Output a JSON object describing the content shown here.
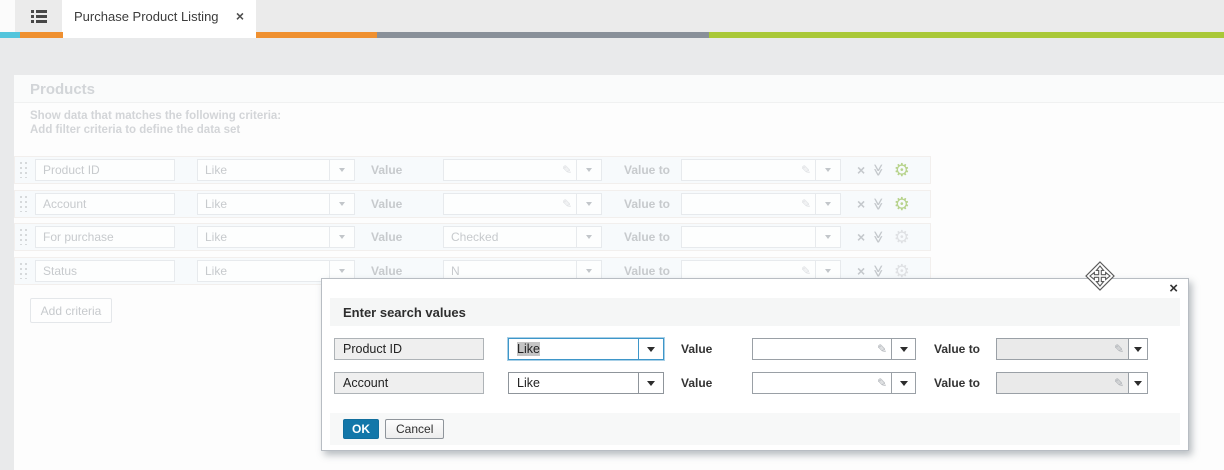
{
  "tab_bar": {
    "tab_label": "Purchase Product Listing",
    "tab_close": "×"
  },
  "panel": {
    "title": "Products",
    "hint_line1": "Show data that matches the following criteria:",
    "hint_line2": "Add filter criteria to define the data set",
    "add_criteria_label": "Add criteria",
    "remove_icon": "×",
    "collapse_icon": "≫",
    "gear_icon": "⚙",
    "rows": [
      {
        "field": "Product ID",
        "operator": "Like",
        "value_label": "Value",
        "value": "",
        "value_to_label": "Value to",
        "value_to": ""
      },
      {
        "field": "Account",
        "operator": "Like",
        "value_label": "Value",
        "value": "",
        "value_to_label": "Value to",
        "value_to": ""
      },
      {
        "field": "For purchase",
        "operator": "Like",
        "value_label": "Value",
        "value": "Checked",
        "value_to_label": "Value to",
        "value_to": ""
      },
      {
        "field": "Status",
        "operator": "Like",
        "value_label": "Value",
        "value": "N",
        "value_to_label": "Value to",
        "value_to": ""
      }
    ]
  },
  "dialog": {
    "title": "Enter search values",
    "close_icon": "×",
    "rows": [
      {
        "field": "Product ID",
        "operator": "Like",
        "value_label": "Value",
        "value": "",
        "value_to_label": "Value to",
        "value_to": ""
      },
      {
        "field": "Account",
        "operator": "Like",
        "value_label": "Value",
        "value": "",
        "value_to_label": "Value to",
        "value_to": ""
      }
    ],
    "ok_label": "OK",
    "cancel_label": "Cancel"
  },
  "icons": {
    "pencil": "✎"
  },
  "colors": {
    "stripe_cyan": "#53c5dc",
    "stripe_orange": "#ef9030",
    "stripe_slate": "#899099",
    "stripe_green": "#a9c838",
    "ok_button_blue": "#1377a9",
    "gear_active_green": "#b7d38c",
    "gear_inactive_gray": "#dfe1e4",
    "focus_border_blue": "#3e96c9"
  }
}
